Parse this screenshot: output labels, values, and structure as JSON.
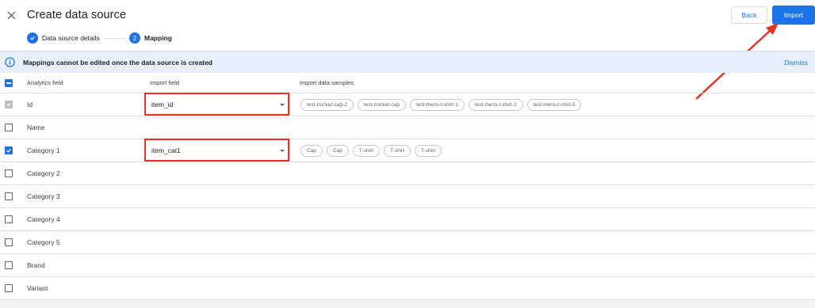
{
  "header": {
    "title": "Create data source",
    "steps": [
      {
        "number": "1",
        "label": "Data source details",
        "state": "done"
      },
      {
        "number": "2",
        "label": "Mapping",
        "state": "active"
      }
    ],
    "back_label": "Back",
    "import_label": "Import"
  },
  "banner": {
    "text": "Mappings cannot be edited once the data source is created",
    "dismiss_label": "Dismiss"
  },
  "table": {
    "columns": [
      "Analytics field",
      "Import field",
      "Import data samples"
    ],
    "rows": [
      {
        "field": "Id",
        "checkbox": "disabled",
        "import_field": "item_id",
        "samples": [
          "test-trucker-cap-2",
          "test-trucker-cap",
          "test-mens-t-shirt-1",
          "test-mens-t-shirt-2",
          "test-mens-t-shirt-3"
        ]
      },
      {
        "field": "Name",
        "checkbox": "unchecked",
        "import_field": "",
        "samples": []
      },
      {
        "field": "Category 1",
        "checkbox": "checked",
        "import_field": "item_cat1",
        "samples": [
          "Cap",
          "Cap",
          "T-shirt",
          "T-shirt",
          "T-shirt"
        ]
      },
      {
        "field": "Category 2",
        "checkbox": "unchecked",
        "import_field": "",
        "samples": []
      },
      {
        "field": "Category 3",
        "checkbox": "unchecked",
        "import_field": "",
        "samples": []
      },
      {
        "field": "Category 4",
        "checkbox": "unchecked",
        "import_field": "",
        "samples": []
      },
      {
        "field": "Category 5",
        "checkbox": "unchecked",
        "import_field": "",
        "samples": []
      },
      {
        "field": "Brand",
        "checkbox": "unchecked",
        "import_field": "",
        "samples": []
      },
      {
        "field": "Variant",
        "checkbox": "unchecked",
        "import_field": "",
        "samples": []
      }
    ]
  },
  "colors": {
    "accent": "#1a73e8",
    "highlight": "#e53222",
    "banner_bg": "#e8f0fe"
  },
  "icons": {
    "close": "close-icon",
    "info": "info-icon",
    "check": "check-icon",
    "dropdown": "dropdown-arrow-icon"
  }
}
